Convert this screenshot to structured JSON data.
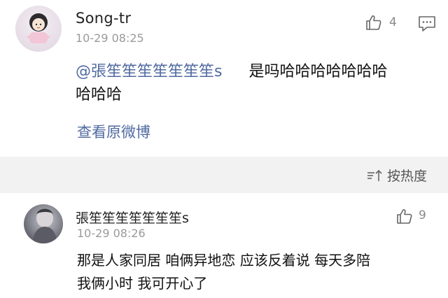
{
  "comment1": {
    "username": "Song-tr",
    "time": "10-29 08:25",
    "like_count": "4",
    "mention": "@張笙笙笙笙笙笙笙s",
    "text_line1": "是吗哈哈哈哈哈哈哈",
    "text_line2": "哈哈哈",
    "view_original": "查看原微博"
  },
  "sort_bar": {
    "label": "按热度"
  },
  "comment2": {
    "username": "張笙笙笙笙笙笙笙s",
    "time": "10-29 08:26",
    "like_count": "9",
    "text_line1": "那是人家同居 咱俩异地恋 应该反着说 每天多陪",
    "text_line2": "我俩小时 我可开心了"
  },
  "colors": {
    "link": "#506aa0",
    "meta": "#9a9a9a",
    "divider_bg": "#f2f2f2"
  },
  "icons": [
    "thumbs-up-icon",
    "comment-icon",
    "sort-icon"
  ]
}
